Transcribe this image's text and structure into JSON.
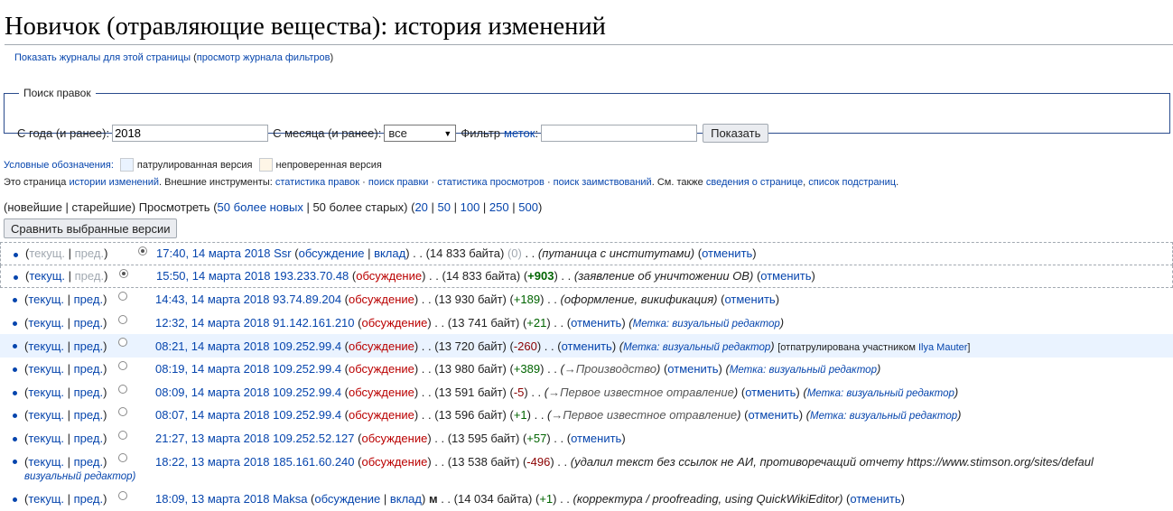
{
  "page_title": "Новичок (отравляющие вещества): история изменений",
  "subnav": {
    "logs": "Показать журналы для этой страницы",
    "filter_log": "просмотр журнала фильтров"
  },
  "search": {
    "legend": "Поиск правок",
    "year_label": "С года (и ранее):",
    "year_value": "2018",
    "month_label": "С месяца (и ранее):",
    "month_value": "все",
    "filter_label": "Фильтр",
    "tags_link": "меток",
    "filter_value": "",
    "show_button": "Показать"
  },
  "legend": {
    "label": "Условные обозначения:",
    "patrolled": "патрулированная версия",
    "unreviewed": "непроверенная версия",
    "colors": {
      "patrolled": "#eaf3ff",
      "unreviewed": "#fef6e7"
    }
  },
  "info": {
    "t1": "Это страница",
    "history_link": "истории изменений",
    "t2": ". Внешние инструменты:",
    "tool1": "статистика правок",
    "tool2": "поиск правки",
    "tool3": "статистика просмотров",
    "tool4": "поиск заимствований",
    "t3": ". См. также",
    "see1": "сведения о странице",
    "see2": "список подстраниц"
  },
  "nav": {
    "newest": "новейшие",
    "oldest": "старейшие",
    "view": "Просмотреть",
    "newer": "50 более новых",
    "older": "50 более старых",
    "limits": [
      "20",
      "50",
      "100",
      "250",
      "500"
    ]
  },
  "compare_button": "Сравнить выбранные версии",
  "row_links": {
    "cur": "текущ.",
    "prev": "пред.",
    "talk": "обсуждение",
    "contribs": "вклад",
    "undo": "отменить",
    "tag": "Метка: визуальный редактор"
  },
  "revisions": [
    {
      "date": "17:40, 14 марта 2018",
      "user": "Ssr",
      "size": "14 833 байта",
      "diff": "(0)",
      "comment": "путаница с институтами"
    },
    {
      "date": "15:50, 14 марта 2018",
      "user": "193.233.70.48",
      "size": "14 833 байта",
      "diff": "+903",
      "comment": "заявление об уничтожении ОВ"
    },
    {
      "date": "14:43, 14 марта 2018",
      "user": "93.74.89.204",
      "size": "13 930 байт",
      "diff": "+189",
      "comment": "оформление, викификация"
    },
    {
      "date": "12:32, 14 марта 2018",
      "user": "91.142.161.210",
      "size": "13 741 байт",
      "diff": "+21"
    },
    {
      "date": "08:21, 14 марта 2018",
      "user": "109.252.99.4",
      "size": "13 720 байт",
      "diff": "-260",
      "patrolled": "[отпатрулирована участником",
      "patroller": "Ilya Mauter"
    },
    {
      "date": "08:19, 14 марта 2018",
      "user": "109.252.99.4",
      "size": "13 980 байт",
      "diff": "+389",
      "section": "→Производство"
    },
    {
      "date": "08:09, 14 марта 2018",
      "user": "109.252.99.4",
      "size": "13 591 байт",
      "diff": "-5",
      "section": "→Первое известное отравление"
    },
    {
      "date": "08:07, 14 марта 2018",
      "user": "109.252.99.4",
      "size": "13 596 байт",
      "diff": "+1",
      "section": "→Первое известное отравление"
    },
    {
      "date": "21:27, 13 марта 2018",
      "user": "109.252.52.127",
      "size": "13 595 байт",
      "diff": "+57"
    },
    {
      "date": "18:22, 13 марта 2018",
      "user": "185.161.60.240",
      "size": "13 538 байт",
      "diff": "-496",
      "comment": "удалил текст без ссылок не АИ, противоречащий отчету https://www.stimson.org/sites/defaul",
      "tag_wrap": "визуальный редактор)"
    },
    {
      "date": "18:09, 13 марта 2018",
      "user": "Maksa",
      "size": "14 034 байта",
      "diff": "+1",
      "minor": "м",
      "comment": "корректура / proofreading, using QuickWikiEditor"
    }
  ]
}
